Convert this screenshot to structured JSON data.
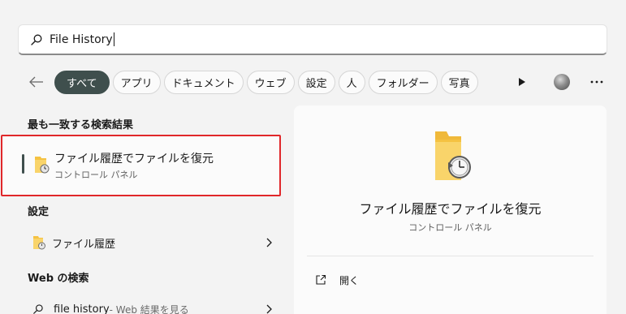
{
  "search": {
    "value": "File History"
  },
  "filters": {
    "chips": [
      "すべて",
      "アプリ",
      "ドキュメント",
      "ウェブ",
      "設定",
      "人",
      "フォルダー",
      "写真"
    ]
  },
  "best_match": {
    "header": "最も一致する検索結果",
    "title": "ファイル履歴でファイルを復元",
    "subtitle": "コントロール パネル"
  },
  "settings": {
    "header": "設定",
    "item_label": "ファイル履歴"
  },
  "web": {
    "header": "Web の検索",
    "query": "file history",
    "suffix": " - Web 結果を見る"
  },
  "preview": {
    "title": "ファイル履歴でファイルを復元",
    "subtitle": "コントロール パネル",
    "action_open": "開く"
  },
  "colors": {
    "accent": "#3f4f4d",
    "highlight": "#e0272a",
    "folder": "#f5c242"
  },
  "icons": {
    "search": "search-icon",
    "back": "back-arrow-icon",
    "play": "play-icon",
    "more": "more-icon",
    "file_history": "file-history-icon",
    "chevron": "chevron-right-icon",
    "open": "open-external-icon"
  }
}
